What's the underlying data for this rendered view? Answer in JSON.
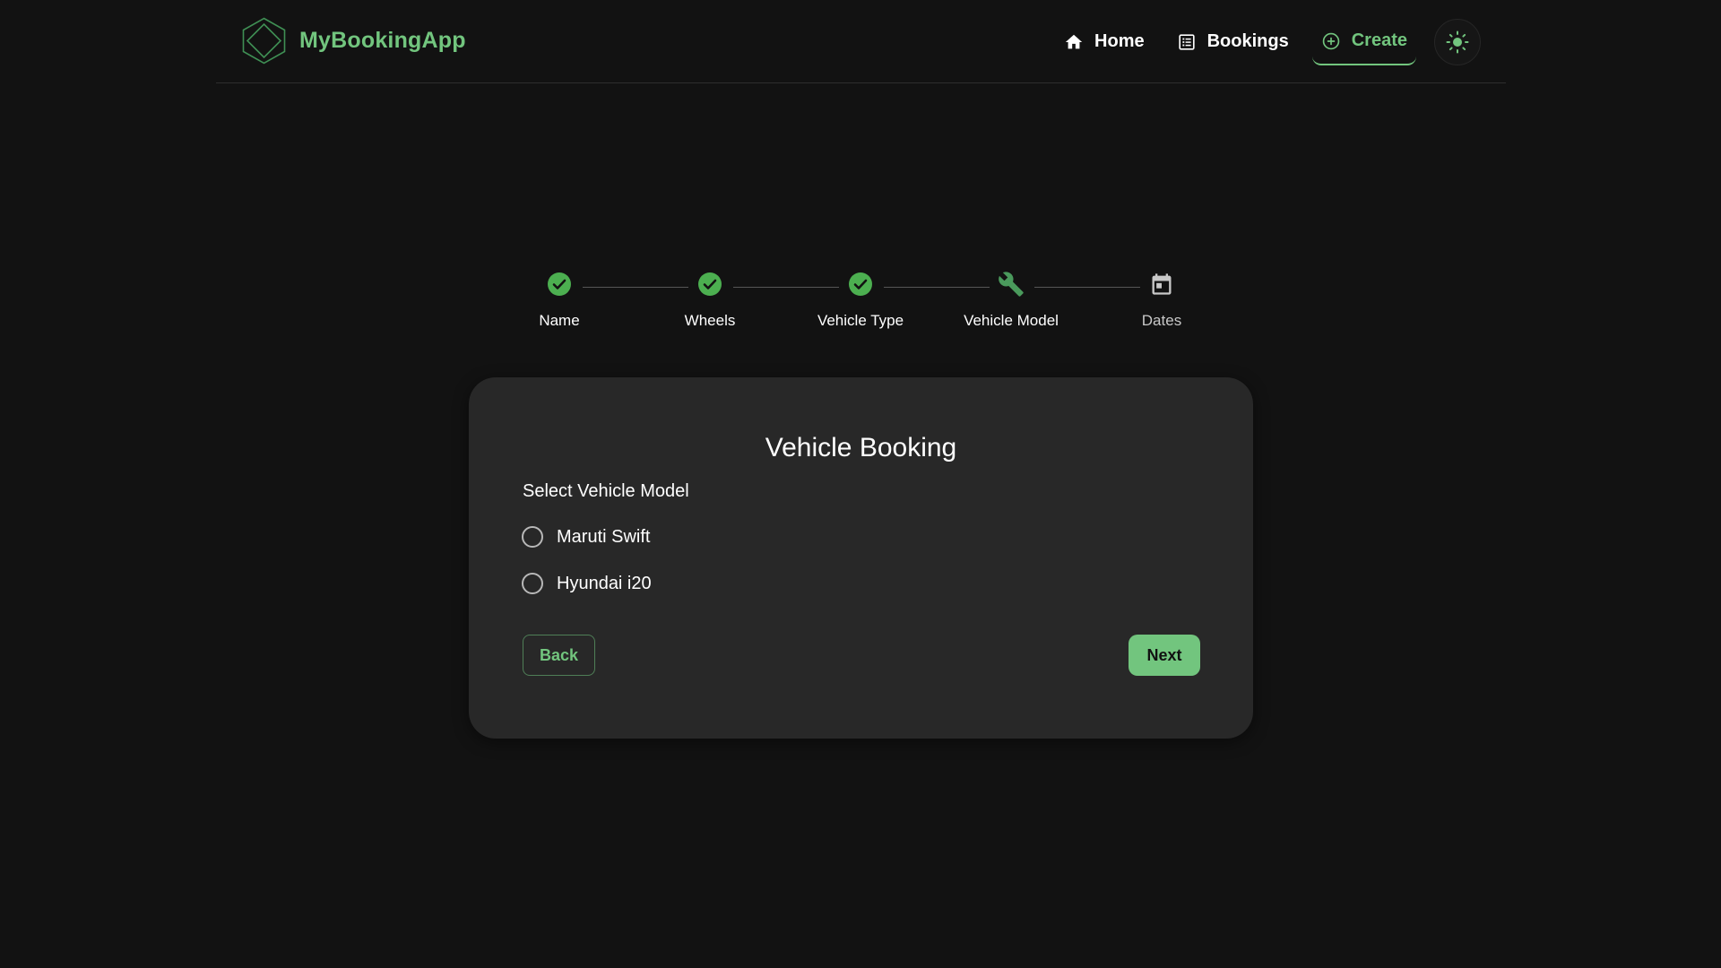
{
  "header": {
    "brand_name": "MyBookingApp",
    "nav": {
      "home_label": "Home",
      "bookings_label": "Bookings",
      "create_label": "Create"
    },
    "icons": {
      "logo": "hexagon-diamond-logo",
      "home": "home-icon",
      "bookings": "list-icon",
      "create": "plus-circle-icon",
      "theme_toggle": "sun-icon"
    }
  },
  "stepper": {
    "steps": [
      {
        "label": "Name",
        "status": "completed",
        "icon": "check-circle-icon"
      },
      {
        "label": "Wheels",
        "status": "completed",
        "icon": "check-circle-icon"
      },
      {
        "label": "Vehicle Type",
        "status": "completed",
        "icon": "check-circle-icon"
      },
      {
        "label": "Vehicle Model",
        "status": "active",
        "icon": "wrench-icon"
      },
      {
        "label": "Dates",
        "status": "pending",
        "icon": "calendar-icon"
      }
    ]
  },
  "form": {
    "title": "Vehicle Booking",
    "field_label": "Select Vehicle Model",
    "options": [
      {
        "label": "Maruti Swift",
        "selected": false
      },
      {
        "label": "Hyundai i20",
        "selected": false
      }
    ],
    "back_label": "Back",
    "next_label": "Next"
  },
  "colors": {
    "accent": "#72c57e",
    "step_check": "#4caf50",
    "background": "#121212",
    "card": "#282828"
  }
}
